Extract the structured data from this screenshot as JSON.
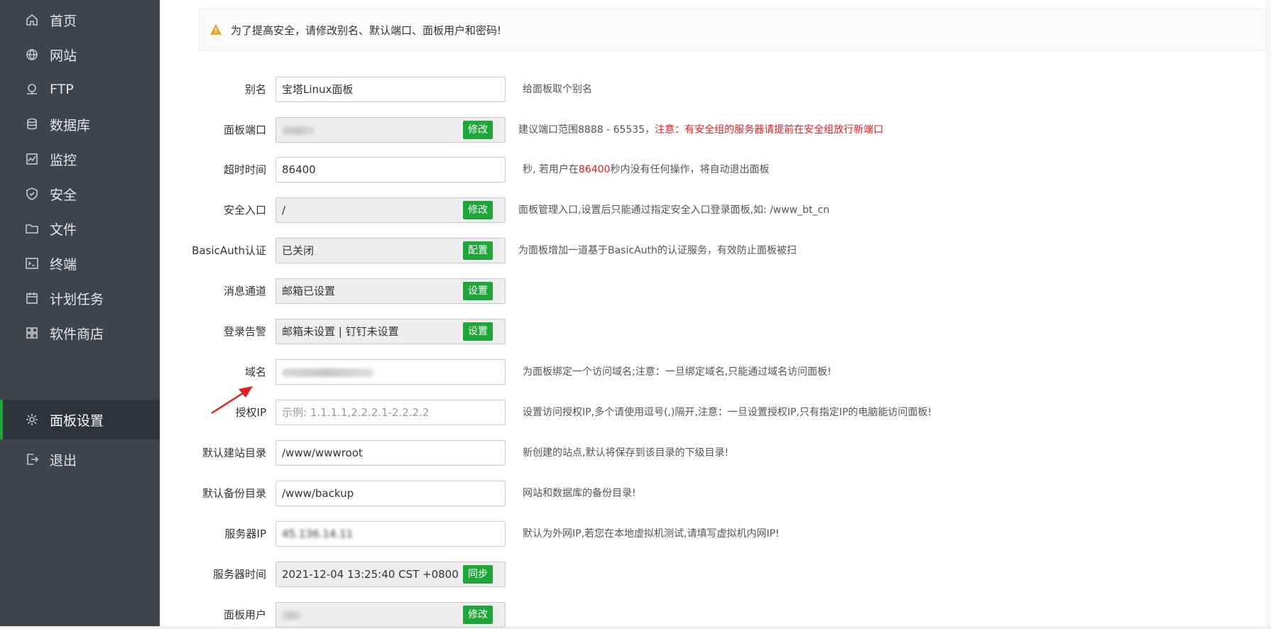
{
  "sidebar": {
    "items": [
      {
        "label": "首页",
        "icon": "home-icon"
      },
      {
        "label": "网站",
        "icon": "globe-icon"
      },
      {
        "label": "FTP",
        "icon": "ftp-icon"
      },
      {
        "label": "数据库",
        "icon": "database-icon"
      },
      {
        "label": "监控",
        "icon": "monitor-icon"
      },
      {
        "label": "安全",
        "icon": "shield-icon"
      },
      {
        "label": "文件",
        "icon": "folder-icon"
      },
      {
        "label": "终端",
        "icon": "terminal-icon"
      },
      {
        "label": "计划任务",
        "icon": "calendar-icon"
      },
      {
        "label": "软件商店",
        "icon": "apps-icon"
      },
      {
        "label": "面板设置",
        "icon": "gear-icon",
        "active": true
      },
      {
        "label": "退出",
        "icon": "logout-icon"
      }
    ]
  },
  "alert": {
    "text": "为了提高安全，请修改别名、默认端口、面板用户和密码!",
    "icon": "warning-icon"
  },
  "form": {
    "alias": {
      "label": "别名",
      "value": "宝塔Linux面板",
      "hint": "给面板取个别名"
    },
    "port": {
      "label": "面板端口",
      "value": "8888",
      "button": "修改",
      "hint": "建议端口范围8888 - 65535，",
      "hint_red": "注意：有安全组的服务器请提前在安全组放行新端口"
    },
    "timeout": {
      "label": "超时时间",
      "value": "86400",
      "hint_pre": "秒, 若用户在",
      "hint_red": "86400",
      "hint_post": "秒内没有任何操作，将自动退出面板"
    },
    "entry": {
      "label": "安全入口",
      "value": "/",
      "button": "修改",
      "hint": "面板管理入口,设置后只能通过指定安全入口登录面板,如: /www_bt_cn"
    },
    "basicauth": {
      "label": "BasicAuth认证",
      "value": "已关闭",
      "button": "配置",
      "hint": "为面板增加一道基于BasicAuth的认证服务，有效防止面板被扫"
    },
    "message": {
      "label": "消息通道",
      "value": "邮箱已设置",
      "button": "设置"
    },
    "login_alert": {
      "label": "登录告警",
      "value": "邮箱未设置 | 钉钉未设置",
      "button": "设置"
    },
    "domain": {
      "label": "域名",
      "hint": "为面板绑定一个访问域名;注意：一旦绑定域名,只能通过域名访问面板!"
    },
    "auth_ip": {
      "label": "授权IP",
      "placeholder": "示例: 1.1.1.1,2.2.2.1-2.2.2.2",
      "hint": "设置访问授权IP,多个请使用逗号(,)隔开,注意：一旦设置授权IP,只有指定IP的电脑能访问面板!"
    },
    "site_dir": {
      "label": "默认建站目录",
      "value": "/www/wwwroot",
      "hint": "新创建的站点,默认将保存到该目录的下级目录!"
    },
    "backup_dir": {
      "label": "默认备份目录",
      "value": "/www/backup",
      "hint": "网站和数据库的备份目录!"
    },
    "server_ip": {
      "label": "服务器IP",
      "value": "45.136.14.11",
      "hint": "默认为外网IP,若您在本地虚拟机测试,请填写虚拟机内网IP!"
    },
    "server_time": {
      "label": "服务器时间",
      "value": "2021-12-04 13:25:40 CST +0800",
      "button": "同步"
    },
    "panel_user": {
      "label": "面板用户",
      "button": "修改"
    }
  },
  "colors": {
    "sidebar_bg": "#3c444d",
    "accent": "#20a53a",
    "warning": "#e02020"
  }
}
